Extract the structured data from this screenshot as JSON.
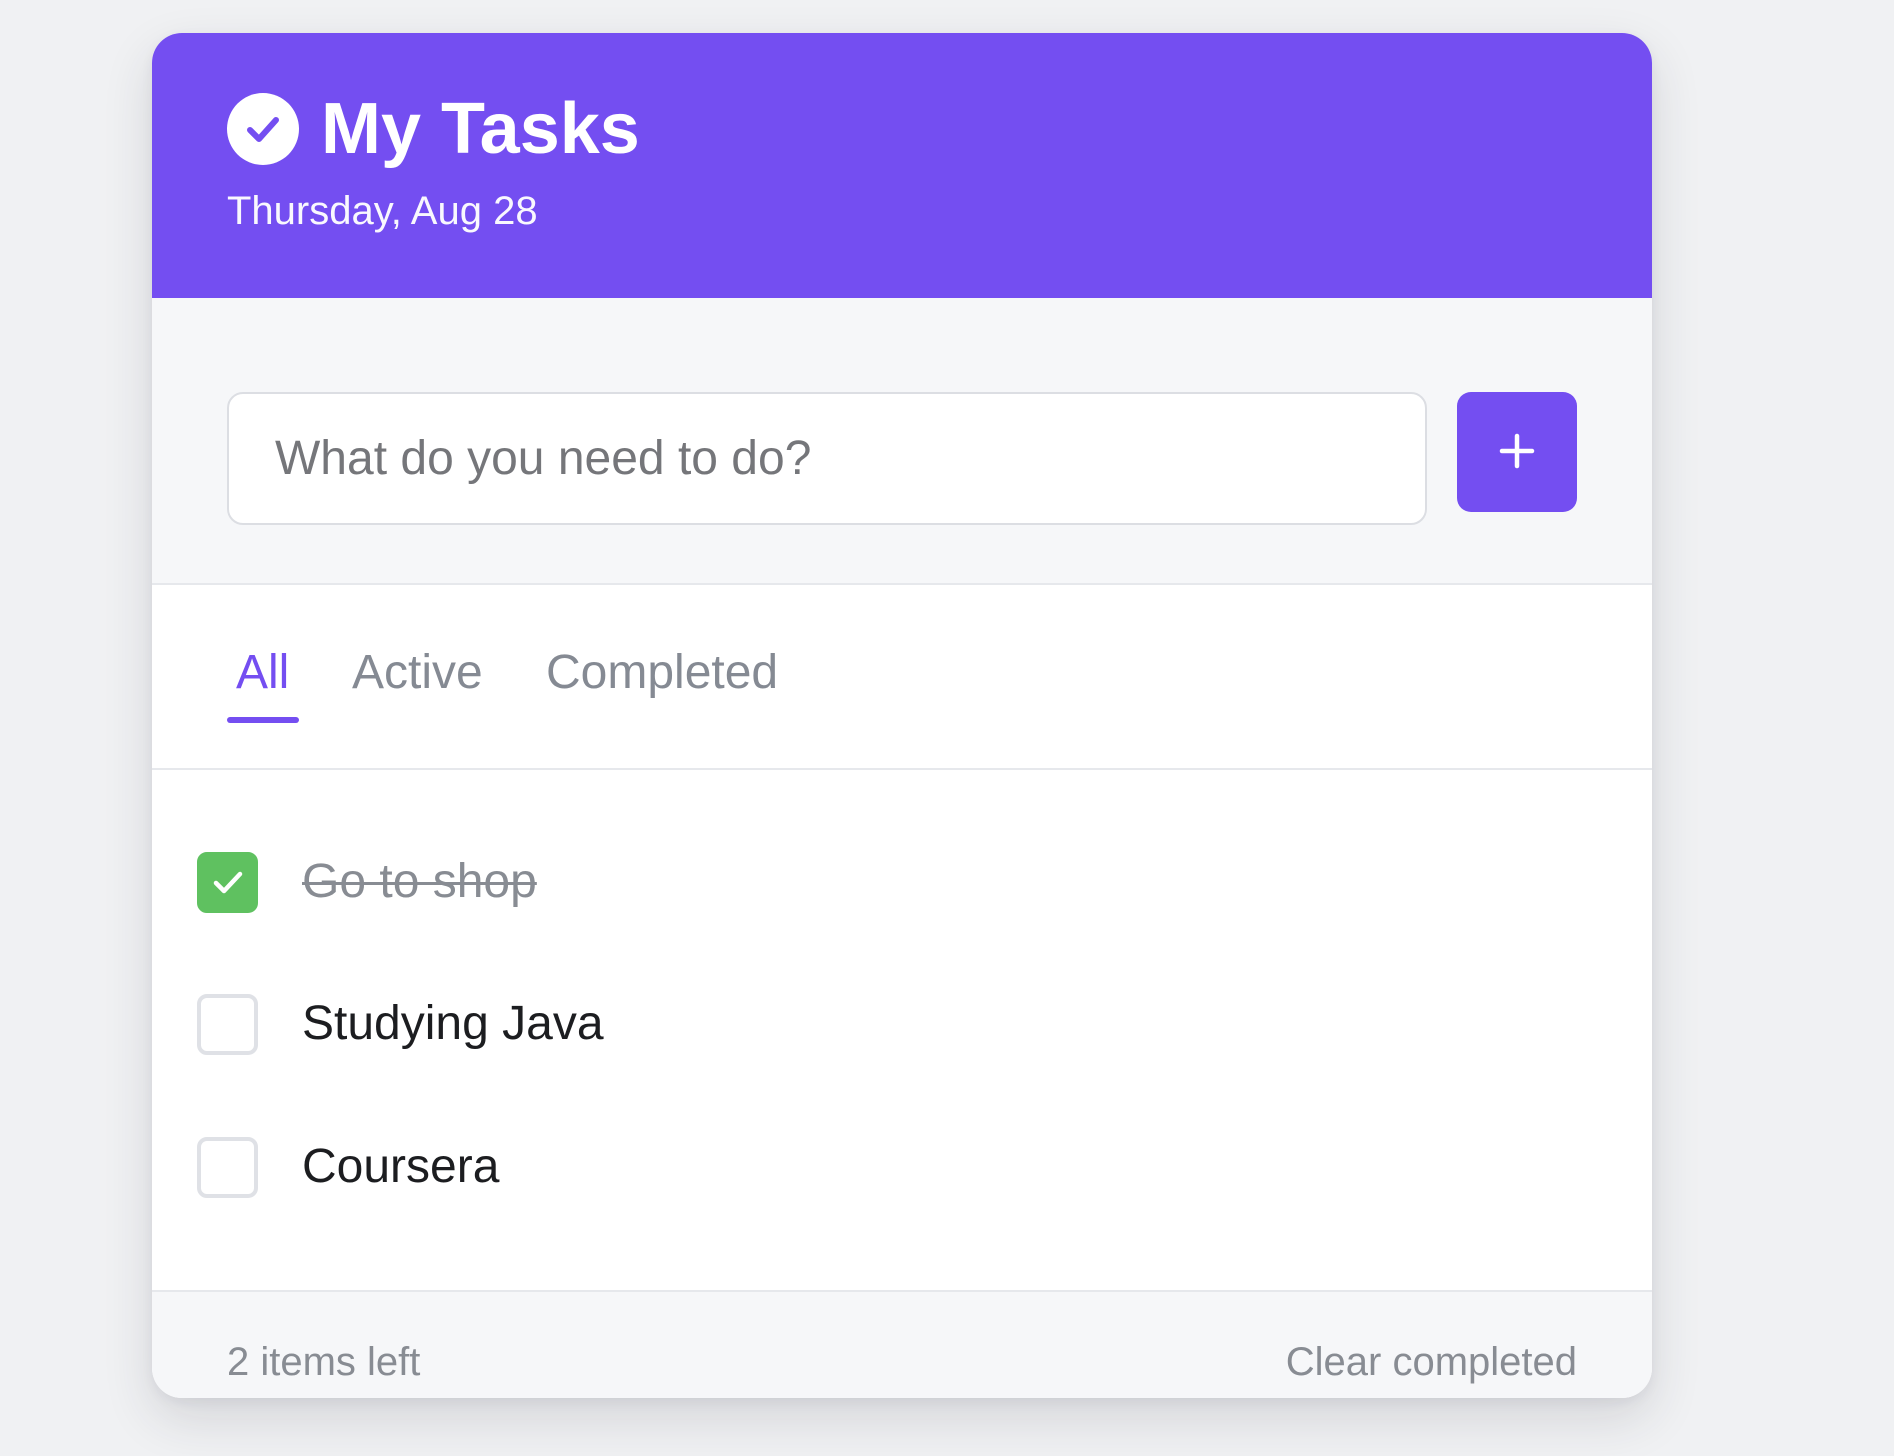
{
  "colors": {
    "accent": "#744ef1",
    "completed_check": "#5fc160",
    "muted_text": "#888c93",
    "page_background": "#f0f1f3"
  },
  "header": {
    "icon": "check-circle-icon",
    "title": "My Tasks",
    "date": "Thursday, Aug 28"
  },
  "new_task": {
    "placeholder": "What do you need to do?",
    "value": "",
    "add_button_icon": "plus-icon"
  },
  "tabs": [
    {
      "label": "All",
      "active": true
    },
    {
      "label": "Active",
      "active": false
    },
    {
      "label": "Completed",
      "active": false
    }
  ],
  "tasks": [
    {
      "label": "Go to shop",
      "completed": true
    },
    {
      "label": "Studying Java",
      "completed": false
    },
    {
      "label": "Coursera",
      "completed": false
    }
  ],
  "footer": {
    "items_left": "2 items left",
    "clear_label": "Clear completed"
  }
}
